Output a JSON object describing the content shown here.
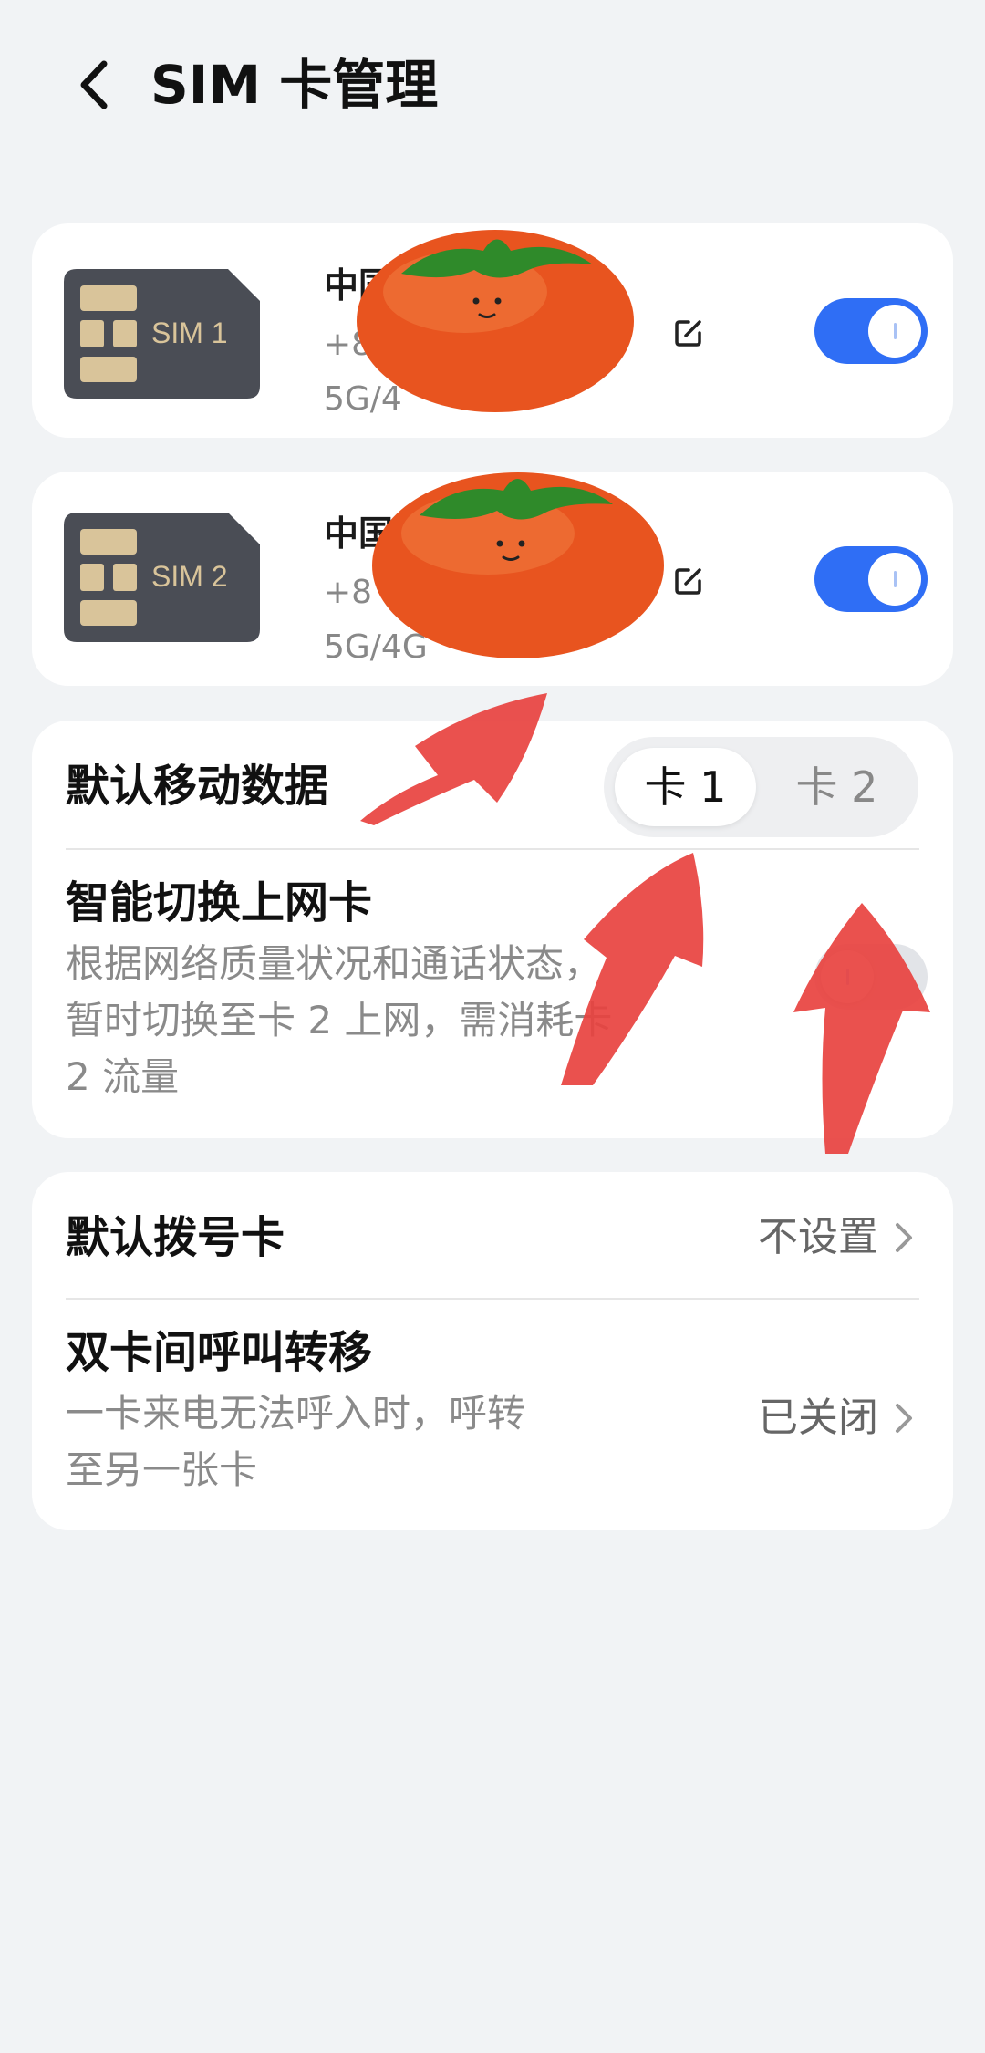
{
  "header": {
    "title": "SIM 卡管理"
  },
  "sims": [
    {
      "chip_label": "SIM 1",
      "carrier": "中国",
      "number": "+8",
      "network": "5G/4",
      "enabled": true
    },
    {
      "chip_label": "SIM 2",
      "carrier": "中国",
      "number": "+8",
      "network": "5G/4G",
      "enabled": true
    }
  ],
  "data_card": {
    "title": "默认移动数据",
    "options": [
      "卡 1",
      "卡 2"
    ],
    "selected": "卡 1",
    "smart_switch_title": "智能切换上网卡",
    "smart_switch_desc": "根据网络质量状况和通话状态，\n暂时切换至卡 2 上网，需消耗卡\n2 流量",
    "smart_switch_enabled": false
  },
  "call_card": {
    "default_dial_title": "默认拨号卡",
    "default_dial_value": "不设置",
    "forward_title": "双卡间呼叫转移",
    "forward_desc": "一卡来电无法呼入时，呼转\n至另一张卡",
    "forward_value": "已关闭"
  },
  "colors": {
    "accent": "#2f6ef5",
    "background": "#f1f3f5",
    "card": "#ffffff",
    "annotation_red": "#e8423f",
    "tomato": "#e8541f",
    "leaf": "#2f8a2a"
  },
  "icons": [
    "back-arrow-icon",
    "sim-chip-icon",
    "edit-icon",
    "chevron-right-icon",
    "tomato-sticker",
    "red-arrow-annotation"
  ]
}
